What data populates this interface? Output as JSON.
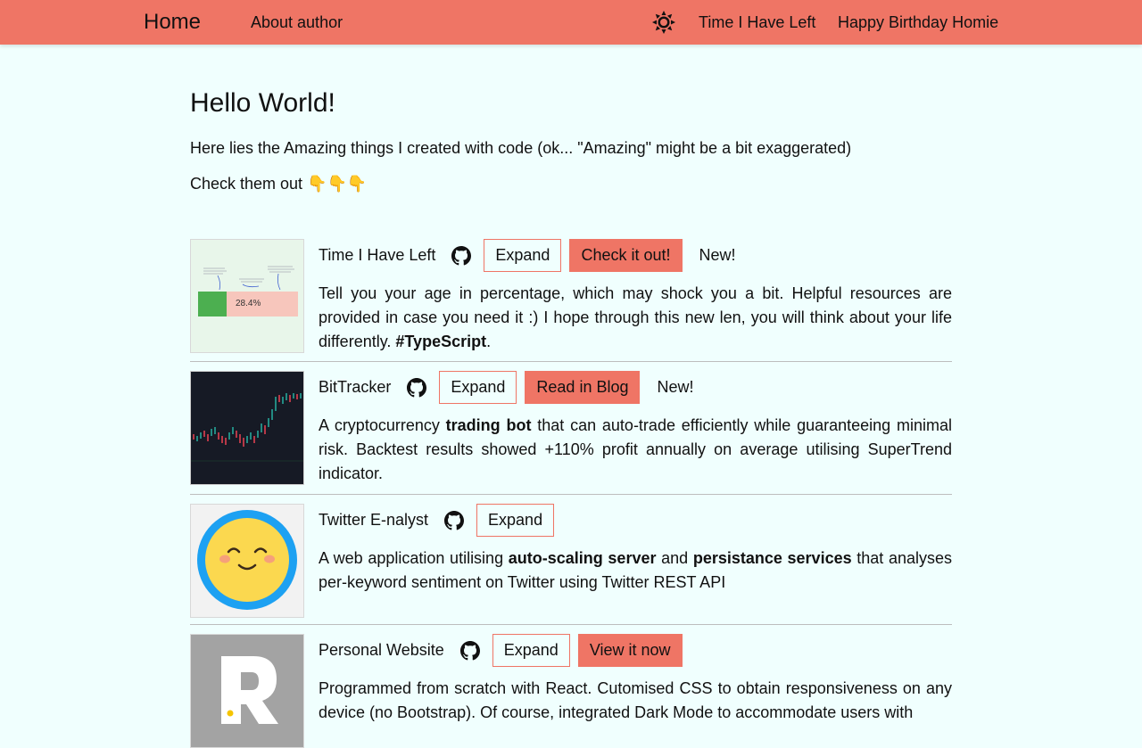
{
  "nav": {
    "home": "Home",
    "about": "About author",
    "links": [
      "Time I Have Left",
      "Happy Birthday Homie"
    ]
  },
  "main": {
    "heading": "Hello World!",
    "intro": "Here lies the Amazing things I created with code (ok... \"Amazing\" might be a bit exaggerated)",
    "check": "Check them out",
    "check_emoji": "👇👇👇"
  },
  "projects": [
    {
      "title": "Time I Have Left",
      "expand": "Expand",
      "action": "Check it out!",
      "tag": "New!",
      "thumb_percent": "28.4%",
      "desc": [
        "Tell you your age in percentage, which may shock you a bit. Helpful resources are provided in case you need it :) I hope through this new len, you will think about your life differently. ",
        "#TypeScript",
        "."
      ]
    },
    {
      "title": "BitTracker",
      "expand": "Expand",
      "action": "Read in Blog",
      "tag": "New!",
      "desc": [
        "A cryptocurrency ",
        "trading bot",
        " that can auto-trade efficiently while guaranteeing minimal risk. Backtest results showed +110% profit annually on average utilising SuperTrend indicator."
      ]
    },
    {
      "title": "Twitter E-nalyst",
      "expand": "Expand",
      "desc": [
        "A web application utilising ",
        "auto-scaling server",
        " and ",
        "persistance services",
        " that analyses per-keyword sentiment on Twitter using Twitter REST API"
      ]
    },
    {
      "title": "Personal Website",
      "expand": "Expand",
      "action": "View it now",
      "desc": [
        "Programmed from scratch with React. Cutomised CSS to obtain responsiveness on any device (no Bootstrap). Of course, integrated Dark Mode to accommodate users with"
      ]
    }
  ],
  "colors": {
    "accent": "#ef7565",
    "background": "#f0fffe"
  }
}
